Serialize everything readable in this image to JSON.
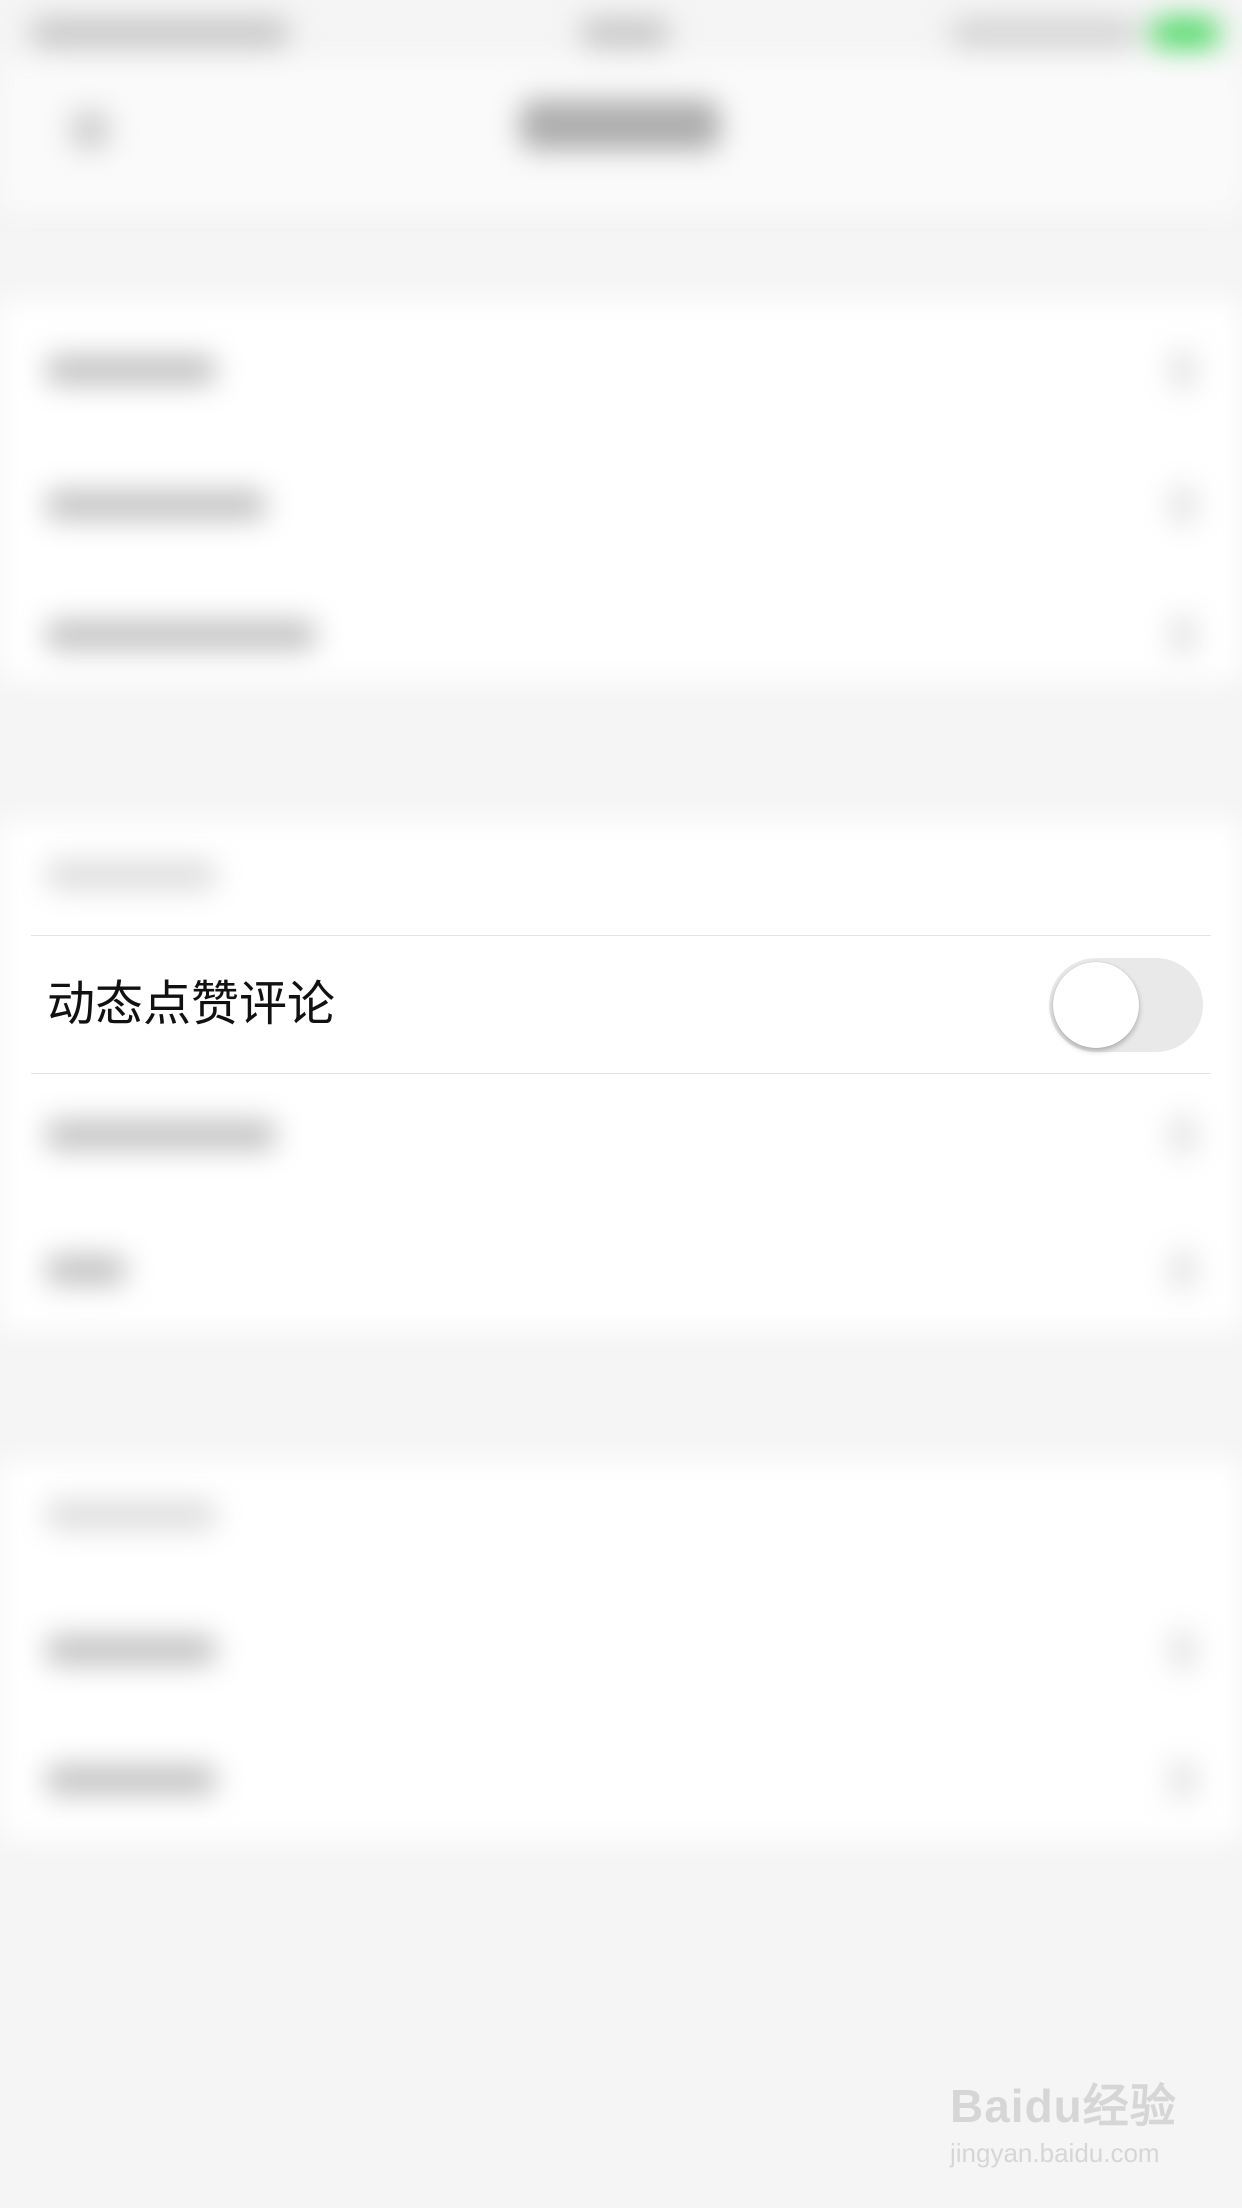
{
  "setting_row": {
    "label": "动态点赞评论",
    "toggle_on": false
  },
  "watermark": {
    "brand": "Baidu经验",
    "url": "jingyan.baidu.com"
  },
  "colors": {
    "status_bar_battery": "#4cd964",
    "toggle_off_track": "#e9e9ea",
    "page_background": "#f5f5f5"
  }
}
